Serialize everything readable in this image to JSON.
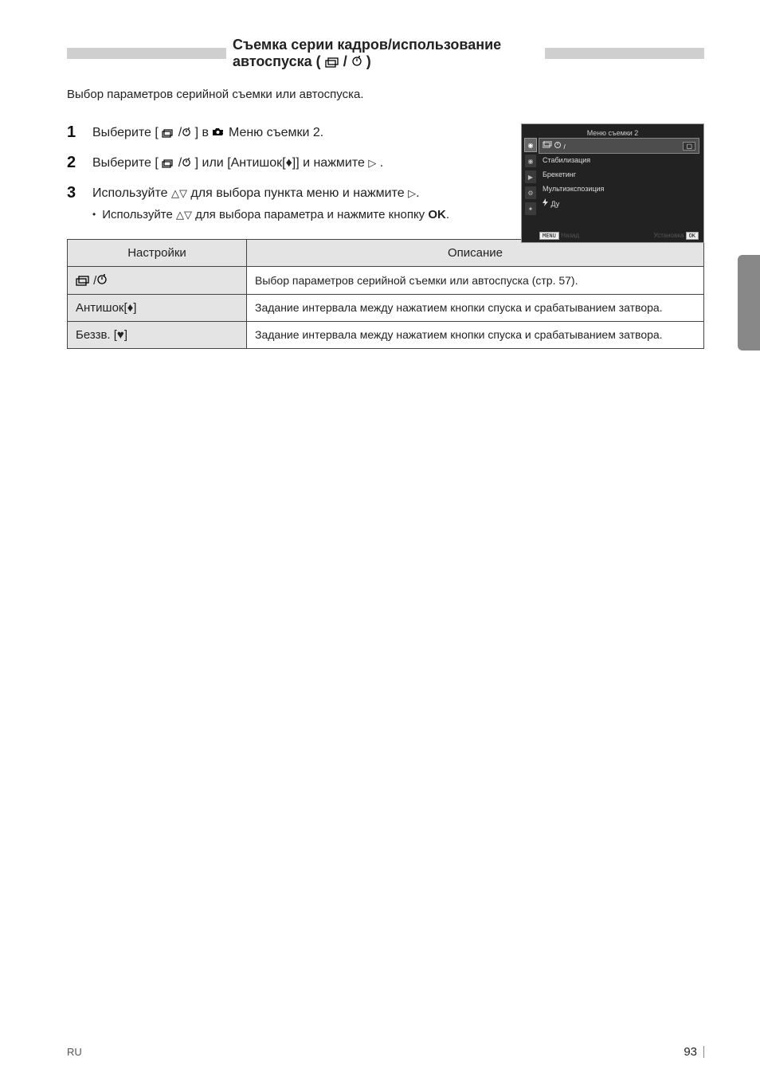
{
  "header": {
    "title_left": "Съемка серии кадров/использование автоспуска (",
    "title_right": ")",
    "icon_burst": "burst-icon",
    "icon_timer": "timer-icon"
  },
  "section": {
    "subtitle": "Выбор параметров серийной съемки или автоспуска."
  },
  "steps": [
    {
      "num": "1",
      "text_before": "Выберите [",
      "text_mid": "] в ",
      "text_after": " Меню съемки 2."
    },
    {
      "num": "2",
      "text": "Выберите [",
      "text_mid": "] или [Антишок[♦]] и нажмите ",
      "text_after": ".",
      "arrow": "I"
    },
    {
      "num": "3",
      "text": "Используйте ",
      "text_mid": " для выбора пункта меню и нажмите ",
      "arrow": "I",
      "sub": "Используйте FG для выбора параметра и нажмите кнопку OK."
    }
  ],
  "menu": {
    "titlebar": "Меню съемки 2",
    "tabs": [
      "◉",
      "◉",
      "▶",
      "⚙",
      "✦"
    ],
    "rows": [
      {
        "label_icon": "burst-timer",
        "label": "",
        "val": "▢",
        "hl": true
      },
      {
        "label": "Стабилизация",
        "val": ""
      },
      {
        "label": "Брекетинг",
        "val": ""
      },
      {
        "label": "Мультиэкспозиция",
        "val": ""
      },
      {
        "label_icon": "flash",
        "label": " Ду",
        "val": ""
      }
    ],
    "footer_left_key": "MENU",
    "footer_left": "Назад",
    "footer_right": "Установка",
    "footer_right_key": "OK"
  },
  "table": {
    "header": [
      "Настройки",
      "Описание"
    ],
    "rows": [
      {
        "name_icon": "timer",
        "name": "",
        "desc": "Выбор параметров серийной съемки или автоспуска (стр. 57)."
      },
      {
        "name": "Антишок[♦]",
        "desc": "Задание интервала между нажатием кнопки спуска и срабатыванием затвора."
      },
      {
        "name": "Беззв. [♥]",
        "desc": "Задание интервала между нажатием кнопки спуска и срабатыванием затвора."
      }
    ]
  },
  "footer": {
    "left": "RU",
    "page": "93"
  }
}
